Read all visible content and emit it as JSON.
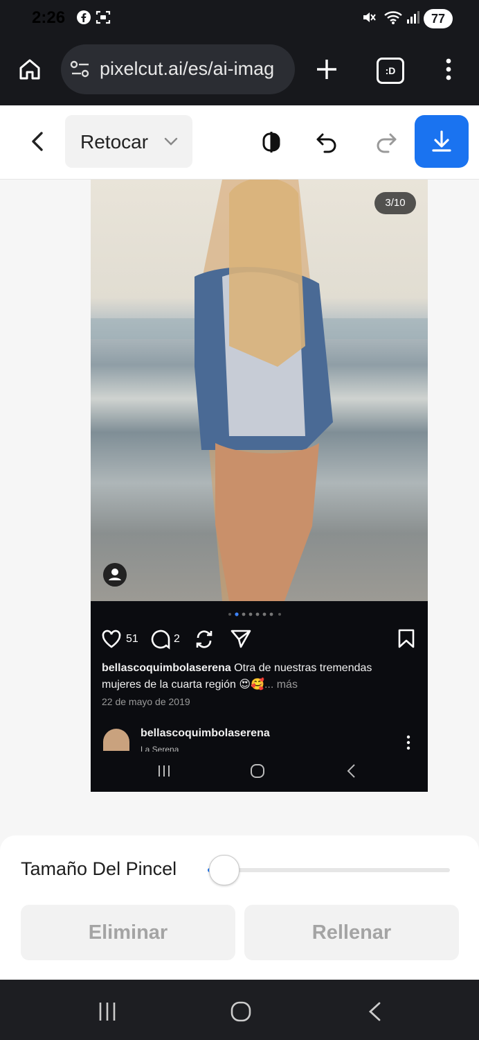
{
  "status_bar": {
    "time": "2:26",
    "battery": "77",
    "icons": [
      "facebook-icon",
      "screenshot-icon",
      "mute-icon",
      "wifi-icon",
      "signal-icon"
    ]
  },
  "browser": {
    "url": "pixelcut.ai/es/ai-imag",
    "icons": [
      "home-icon",
      "site-settings-icon",
      "new-tab-icon",
      "tab-switcher-icon",
      "menu-icon"
    ],
    "tab_switcher_label": ":D"
  },
  "toolbar": {
    "mode_label": "Retocar",
    "icons": [
      "back-icon",
      "chevron-down-icon",
      "compare-icon",
      "undo-icon",
      "redo-icon",
      "download-icon"
    ],
    "accent": "#1a73f0"
  },
  "canvas": {
    "photo_counter": "3/10",
    "post": {
      "likes": "51",
      "comments": "2",
      "caption_user": "bellascoquimbolaserena",
      "caption_text": " Otra de nuestras tremendas mujeres de la cuarta región 😍🥰",
      "caption_more": "... más",
      "date": "22 de mayo de 2019",
      "comment_user": "bellascoquimbolaserena",
      "comment_location": "La Serena"
    }
  },
  "panel": {
    "brush_label": "Tamaño Del Pincel",
    "brush_size": 0.04,
    "erase_label": "Eliminar",
    "fill_label": "Rellenar"
  }
}
